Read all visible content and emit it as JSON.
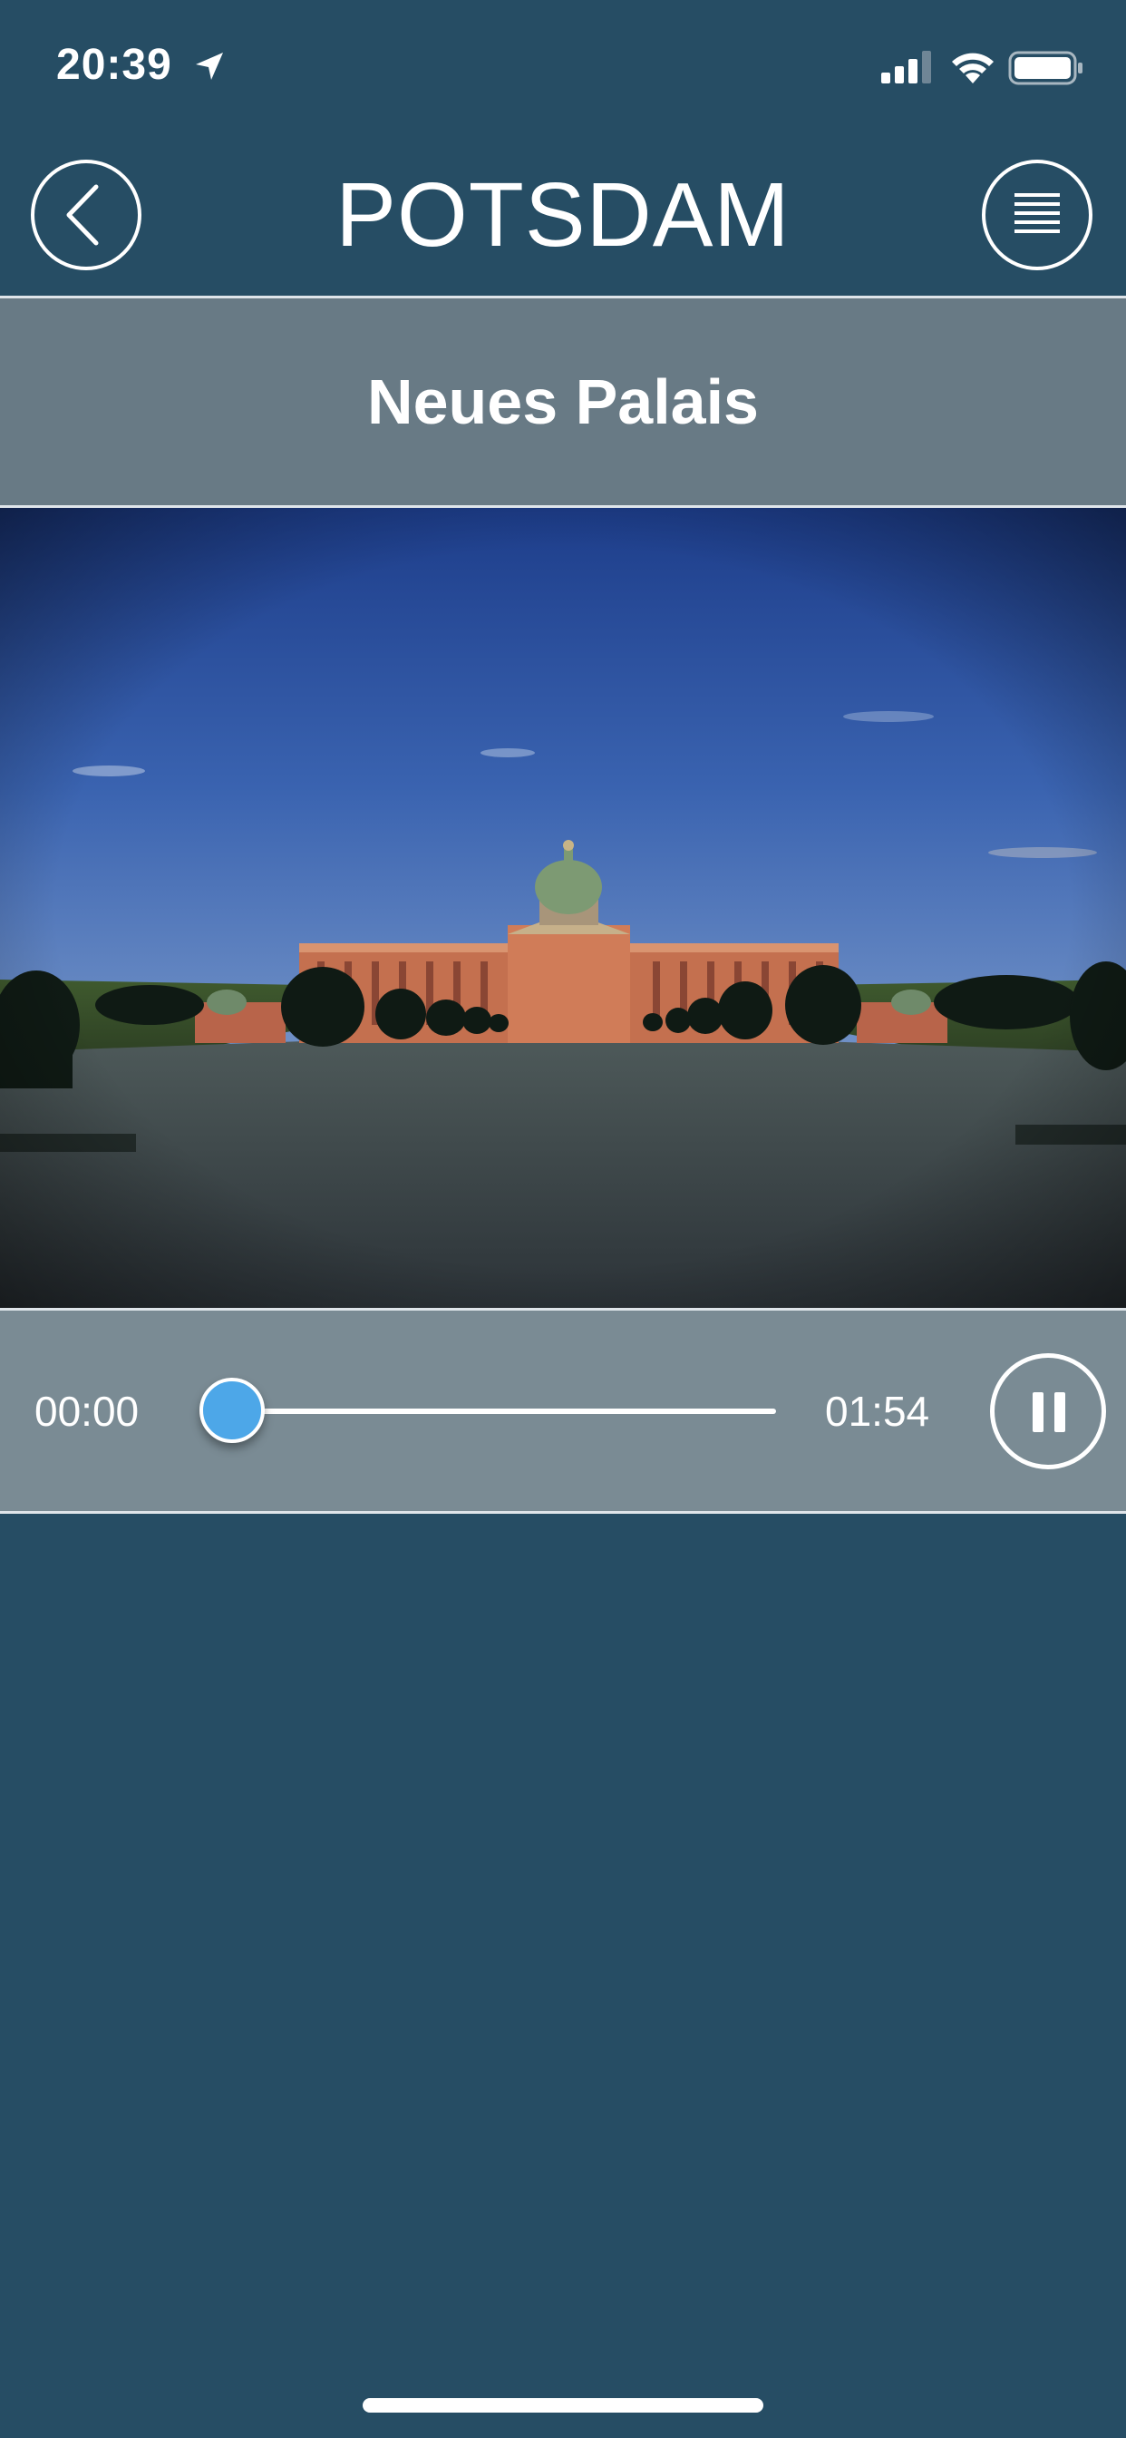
{
  "status_bar": {
    "time": "20:39",
    "icons": [
      "location-arrow-icon",
      "cellular-signal-icon",
      "wifi-icon",
      "battery-icon"
    ]
  },
  "header": {
    "title": "POTSDAM",
    "back_icon": "chevron-left-icon",
    "menu_icon": "hamburger-menu-icon"
  },
  "location": {
    "name": "Neues Palais"
  },
  "hero_image": {
    "subject": "palace-photo"
  },
  "player": {
    "current_time": "00:00",
    "total_time": "01:54",
    "progress": 0,
    "state_icon": "pause-icon"
  },
  "colors": {
    "background": "#264d64",
    "subtitle_bar": "#687a85",
    "player_bar": "#7a8b94",
    "seek_thumb": "#4da7e8",
    "text": "#ffffff"
  }
}
